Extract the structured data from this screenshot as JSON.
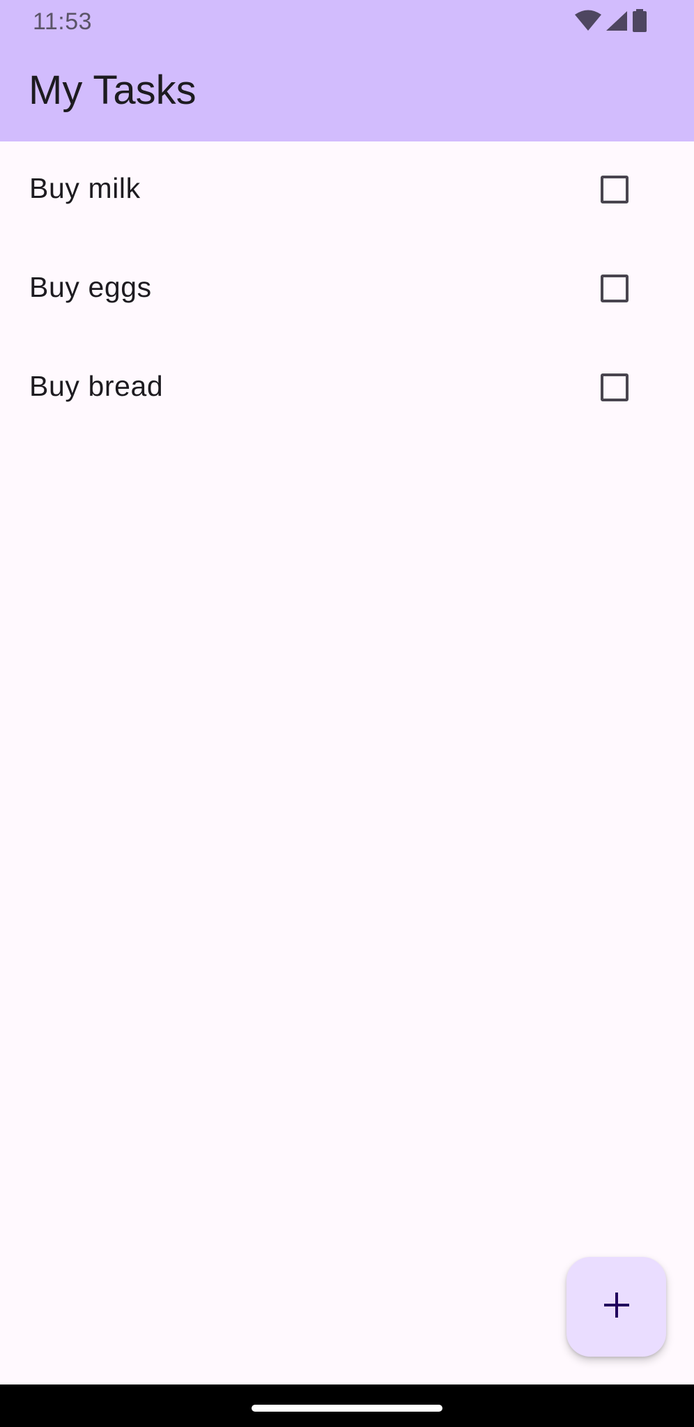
{
  "status_bar": {
    "time": "11:53",
    "icons": [
      "wifi-icon",
      "cellular-signal-icon",
      "battery-icon"
    ]
  },
  "app_bar": {
    "title": "My Tasks"
  },
  "tasks": [
    {
      "label": "Buy milk",
      "checked": false
    },
    {
      "label": "Buy eggs",
      "checked": false
    },
    {
      "label": "Buy bread",
      "checked": false
    }
  ],
  "fab": {
    "icon": "plus-icon"
  },
  "colors": {
    "app_bar": "#D2BCFD",
    "background": "#FFF9FE",
    "fab": "#EADDFF",
    "fab_icon": "#21005D",
    "checkbox_border": "#49454F"
  }
}
